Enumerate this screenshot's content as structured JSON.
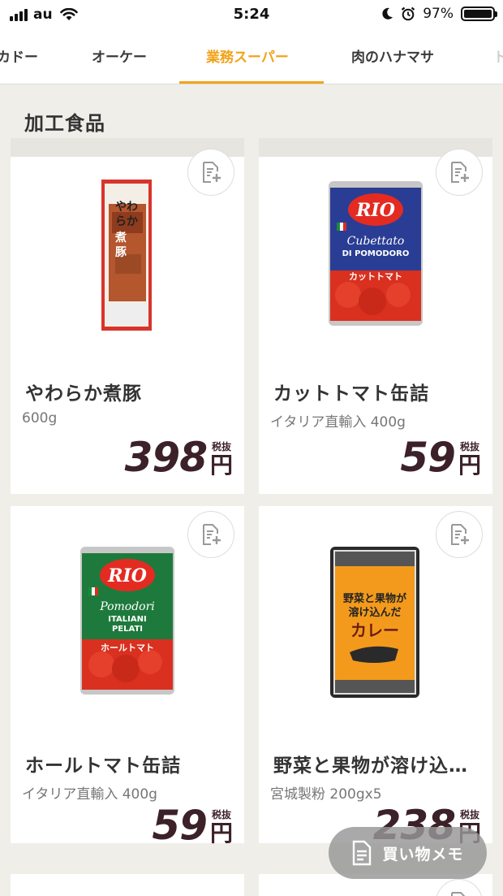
{
  "status_bar": {
    "carrier": "au",
    "time": "5:24",
    "battery": "97%"
  },
  "tabs": [
    {
      "label": "カドー"
    },
    {
      "label": "オーケー"
    },
    {
      "label": "業務スーパー",
      "active": true
    },
    {
      "label": "肉のハナマサ"
    },
    {
      "label": "ト"
    }
  ],
  "section_title": "加工食品",
  "products": [
    {
      "name": "やわらか煮豚",
      "desc": "600g",
      "price": "398",
      "tax": "税抜",
      "yen": "円",
      "image_label": "やわらか煮豚"
    },
    {
      "name": "カットトマト缶詰",
      "desc": "イタリア直輸入 400g",
      "price": "59",
      "tax": "税抜",
      "yen": "円",
      "image_label": "RIO Cubettato DI POMODORO カットトマト"
    },
    {
      "name": "ホールトマト缶詰",
      "desc": "イタリア直輸入 400g",
      "price": "59",
      "tax": "税抜",
      "yen": "円",
      "image_label": "RIO Pomodori ITALIANI PELATI ホールトマト"
    },
    {
      "name": "野菜と果物が溶け込…",
      "desc": "宮城製粉 200gx5",
      "price": "238",
      "tax": "税抜",
      "yen": "円",
      "image_label": "野菜と果物が溶け込んだカレー"
    }
  ],
  "memo_button": {
    "label": "買い物メモ"
  },
  "colors": {
    "accent": "#f2a31b",
    "price": "#3c2129",
    "background": "#efeee9"
  },
  "icons": {
    "memo_add": "document-plus-icon",
    "memo": "document-icon"
  }
}
